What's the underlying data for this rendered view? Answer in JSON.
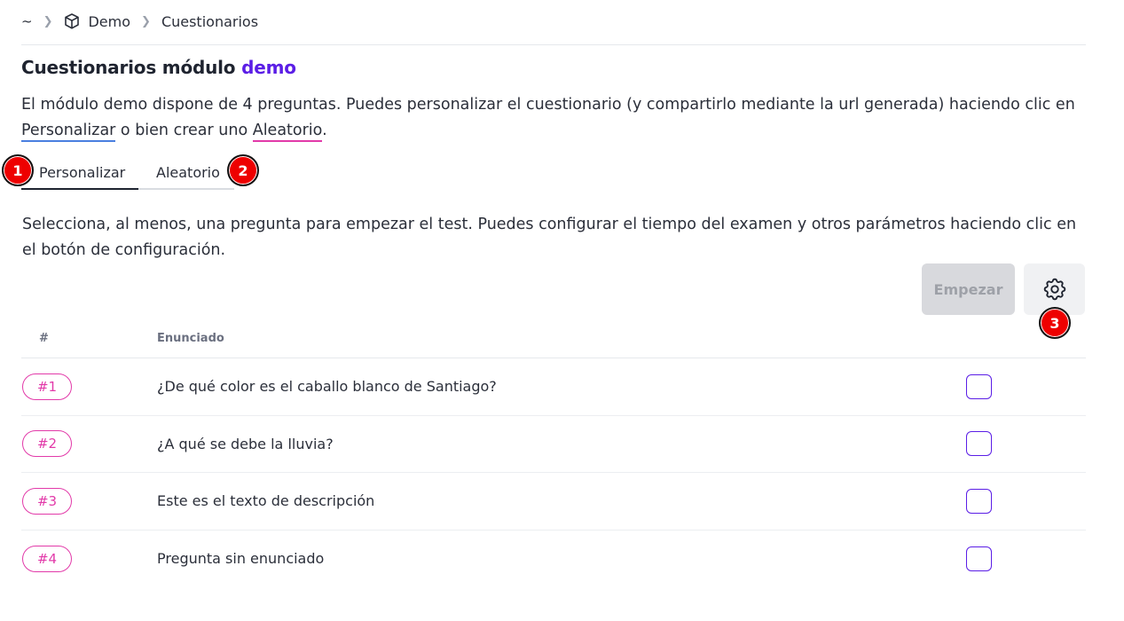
{
  "breadcrumb": {
    "home": "~",
    "items": [
      "Demo",
      "Cuestionarios"
    ]
  },
  "page": {
    "title_prefix": "Cuestionarios módulo ",
    "title_accent": "demo",
    "intro_part1": "El módulo demo dispone de 4 preguntas. Puedes personalizar el cuestionario (y compartirlo mediante la url generada) haciendo clic en ",
    "intro_link1": "Personalizar",
    "intro_part2": " o bien crear uno ",
    "intro_link2": "Aleatorio",
    "intro_part3": "."
  },
  "tabs": [
    "Personalizar",
    "Aleatorio"
  ],
  "markers": [
    "1",
    "2",
    "3"
  ],
  "description": "Selecciona, al menos, una pregunta para empezar el test. Puedes configurar el tiempo del examen y otros parámetros haciendo clic en el botón de configuración.",
  "toolbar": {
    "start_label": "Empezar",
    "config_icon": "gear-icon"
  },
  "table": {
    "headers": [
      "#",
      "Enunciado"
    ],
    "rows": [
      {
        "id": "#1",
        "text": "¿De qué color es el caballo blanco de Santiago?",
        "checked": false
      },
      {
        "id": "#2",
        "text": "¿A qué se debe la lluvia?",
        "checked": false
      },
      {
        "id": "#3",
        "text": "Este es el texto de descripción",
        "checked": false
      },
      {
        "id": "#4",
        "text": "Pregunta sin enunciado",
        "checked": false
      }
    ]
  },
  "colors": {
    "accent": "#5b1ee6",
    "pink": "#e23aa9",
    "link_blue": "#4a7fe0",
    "marker": "#ee0000"
  }
}
